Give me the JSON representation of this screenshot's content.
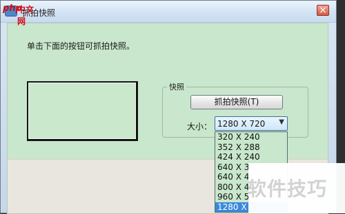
{
  "window": {
    "title": "抓拍快照"
  },
  "watermarks": {
    "php_logo_php": "php",
    "php_logo_cn": "中文网",
    "bottom_right_text": "软件技巧"
  },
  "content": {
    "instruction": "单击下面的按钮可抓拍快照。",
    "group_label": "快照",
    "capture_button_label": "抓拍快照(T)",
    "size_label": "大小："
  },
  "combo": {
    "selected_value": "1280 X 720",
    "options": [
      "320 X 240",
      "352 X 288",
      "424 X 240",
      "640 X 3",
      "640 X 4",
      "800 X 4",
      "960 X 5",
      "1280 X"
    ],
    "highlighted_index": 7
  },
  "icons": {
    "close": "close-icon",
    "dropdown": "chevron-down-icon"
  },
  "colors": {
    "client_background": "#c8e7cc",
    "selection": "#3a89db",
    "close_button": "#d65a44",
    "watermark_red": "#d20b12"
  }
}
